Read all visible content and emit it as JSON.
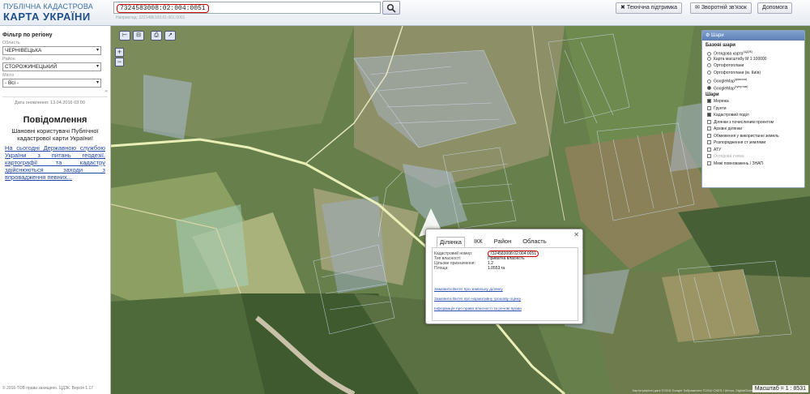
{
  "header": {
    "logo_line1": "ПУБЛІЧНА КАДАСТРОВА",
    "logo_line2": "КАРТА УКРАЇНИ",
    "search_value": "7324583008:02:004:0051",
    "search_hint": "Наприклад: 3221486100:01:001:0001",
    "support_label": "Технічна підтримка",
    "feedback_label": "Зворотній зв'язок",
    "help_label": "Допомога"
  },
  "filter": {
    "title": "Фільтр по регіону",
    "region_label": "Область",
    "region_value": "ЧЕРНІВЕЦЬКА",
    "district_label": "Район",
    "district_value": "СТОРОЖИНЕЦЬКИЙ",
    "city_label": "Місто",
    "city_value": "- Всі -",
    "updated": "Дата оновлення: 13.04.2016 03:00"
  },
  "message": {
    "title": "Повідомлення",
    "body": "Шановні користувачі Публічної кадастрової карти України!",
    "link": "На сьогодні Державною службою України з питань геодезії, картографії та кадастру здійснюються заходи з впровадження певних..."
  },
  "copyright": "© 2016-ТОВ права захищено. ЦДЗК. Версія 1.17",
  "layers": {
    "header": "Шари",
    "base_title": "Базові шари",
    "base": [
      {
        "label": "Оглядова карта",
        "sup": "(ЦДЗК)",
        "on": false,
        "dis": false
      },
      {
        "label": "Карта масштабу М 1:100000",
        "sup": "",
        "on": false,
        "dis": false
      },
      {
        "label": "Ортофотоплани",
        "sup": "",
        "on": false,
        "dis": false
      },
      {
        "label": "Ортофотоплани (м. Київ)",
        "sup": "",
        "on": false,
        "dis": false
      },
      {
        "label": "GoogleMap",
        "sup": "(фізична)",
        "on": false,
        "dis": false
      },
      {
        "label": "GoogleMap",
        "sup": "(супутник)",
        "on": true,
        "dis": false
      }
    ],
    "overlay_title": "Шари",
    "overlays": [
      {
        "label": "Мережа",
        "on": true,
        "dis": false
      },
      {
        "label": "Ґрунти",
        "on": false,
        "dis": false
      },
      {
        "label": "Кадастровий поділ",
        "on": true,
        "dis": false
      },
      {
        "label": "Ділянки з почисленим проектом",
        "on": false,
        "dis": false
      },
      {
        "label": "Архівні ділянки",
        "on": false,
        "dis": false
      },
      {
        "label": "Обмеження у використанні земель",
        "on": false,
        "dis": false
      },
      {
        "label": "Розпорядження ст землями",
        "on": false,
        "dis": false
      },
      {
        "label": "АТУ",
        "on": false,
        "dis": false
      },
      {
        "label": "Оглядова схема",
        "on": false,
        "dis": true
      },
      {
        "label": "Межі повноважень / ЗНАП",
        "on": false,
        "dis": false
      }
    ]
  },
  "popup": {
    "tabs": [
      "Ділянка",
      "ІКК",
      "Район",
      "Область"
    ],
    "rows": [
      {
        "k": "Кадастровий номер:",
        "v": "7324583008:02:004:0051"
      },
      {
        "k": "Тип власності:",
        "v": "Приватна власність"
      },
      {
        "k": "Цільове призначення:",
        "v": "1.2"
      },
      {
        "k": "Площа:",
        "v": "1.0553 га"
      }
    ],
    "links": [
      "Замовити Витяг про земельну ділянку",
      "Замовити Витяг про нормативну грошову оцінку",
      "Інформація про право власності та речові права"
    ]
  },
  "map": {
    "scale": "Масштаб = 1 : 8531",
    "attribution": "Картографічні дані ©2016 Google Зображення ©2016 CNES / Airbus, DigitalGlobe"
  }
}
